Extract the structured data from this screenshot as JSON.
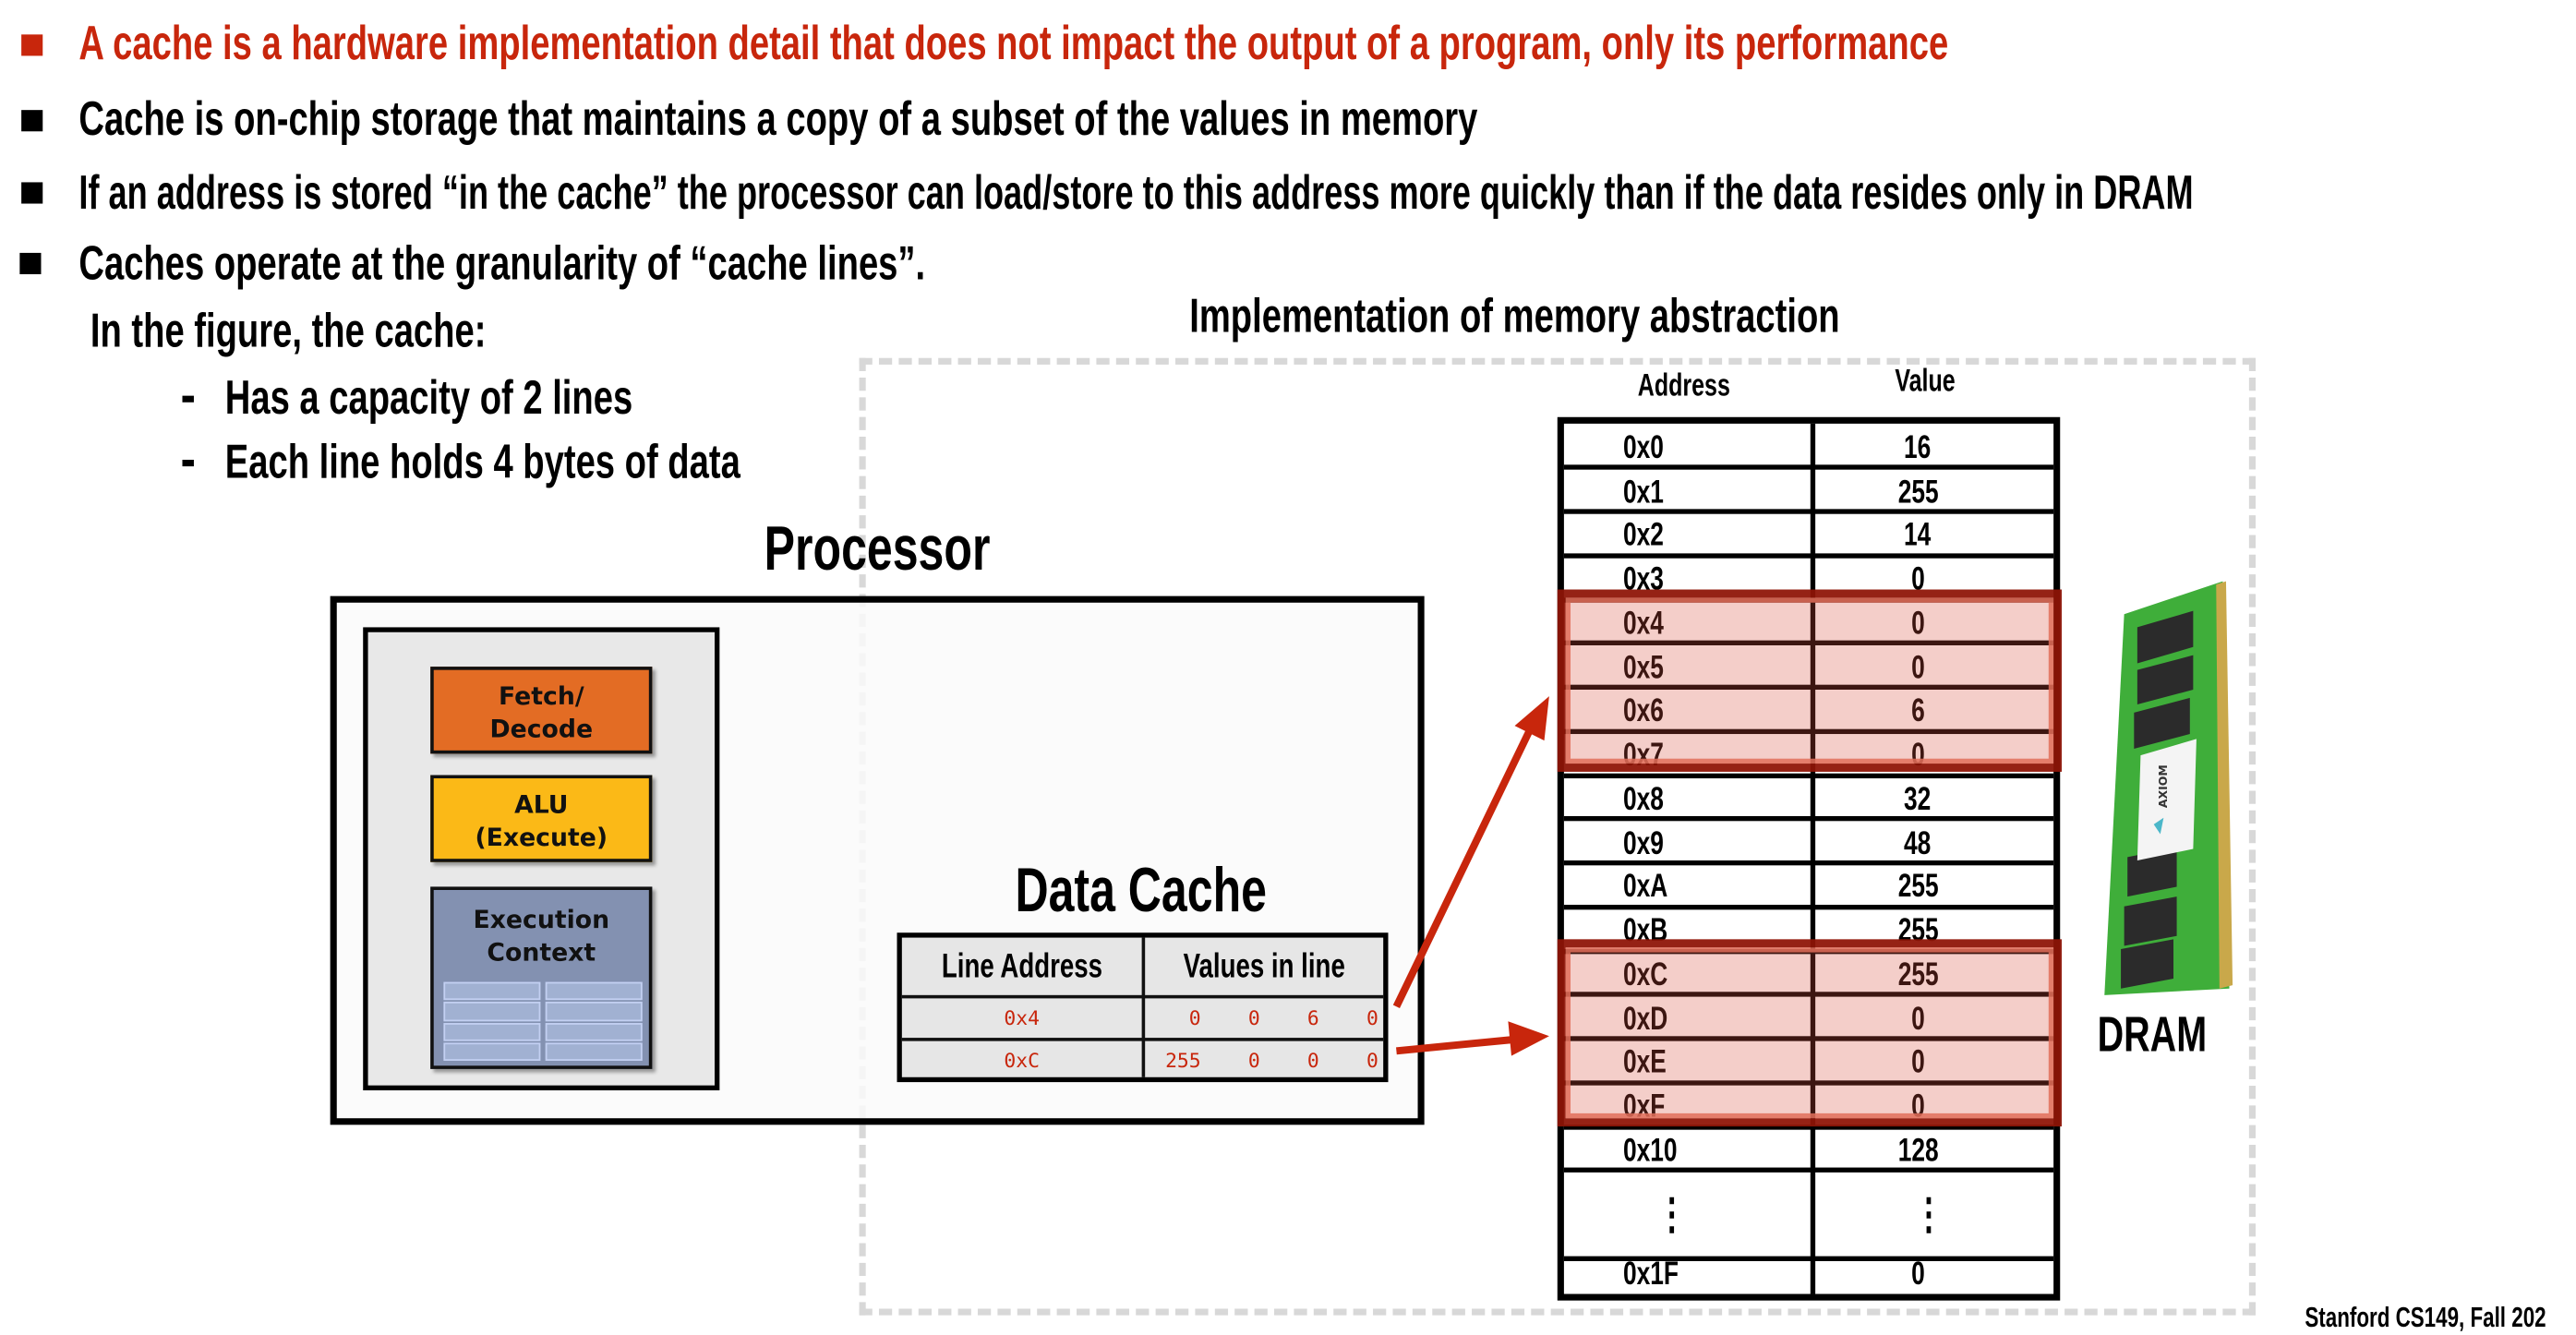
{
  "bullets": [
    {
      "text": "A cache is a hardware implementation detail that does not impact the output of a program, only its performance",
      "color": "#c8260c"
    },
    {
      "text": "Cache is on-chip storage that maintains a copy of a subset of the values in memory",
      "color": "#000000"
    },
    {
      "text": "If an address is stored “in the cache” the processor can load/store to this address more quickly than if the data resides only in DRAM",
      "color": "#000000"
    },
    {
      "text": "Caches operate at the granularity of “cache lines”.",
      "color": "#000000"
    }
  ],
  "figure_intro": "In the figure, the cache:",
  "sub_bullets": [
    "Has a capacity of 2 lines",
    "Each line holds 4 bytes of data"
  ],
  "implementation_title": "Implementation of memory abstraction",
  "processor": {
    "title": "Processor",
    "units": {
      "fetch_decode": [
        "Fetch/",
        "Decode"
      ],
      "alu": [
        "ALU",
        "(Execute)"
      ],
      "execution_context": [
        "Execution",
        "Context"
      ]
    },
    "colors": {
      "fetch_decode": "#e36c24",
      "alu": "#fbb917",
      "execution_context": "#8391b1"
    }
  },
  "data_cache": {
    "title": "Data Cache",
    "headers": [
      "Line Address",
      "Values in line"
    ],
    "rows": [
      {
        "address": "0x4",
        "values": [
          "0",
          "0",
          "6",
          "0"
        ]
      },
      {
        "address": "0xC",
        "values": [
          "255",
          "0",
          "0",
          "0"
        ]
      }
    ],
    "text_color": "#c8260c"
  },
  "memory": {
    "headers": {
      "address": "Address",
      "value": "Value"
    },
    "rows": [
      {
        "address": "0x0",
        "value": "16"
      },
      {
        "address": "0x1",
        "value": "255"
      },
      {
        "address": "0x2",
        "value": "14"
      },
      {
        "address": "0x3",
        "value": "0"
      },
      {
        "address": "0x4",
        "value": "0"
      },
      {
        "address": "0x5",
        "value": "0"
      },
      {
        "address": "0x6",
        "value": "6"
      },
      {
        "address": "0x7",
        "value": "0"
      },
      {
        "address": "0x8",
        "value": "32"
      },
      {
        "address": "0x9",
        "value": "48"
      },
      {
        "address": "0xA",
        "value": "255"
      },
      {
        "address": "0xB",
        "value": "255"
      },
      {
        "address": "0xC",
        "value": "255"
      },
      {
        "address": "0xD",
        "value": "0"
      },
      {
        "address": "0xE",
        "value": "0"
      },
      {
        "address": "0xF",
        "value": "0"
      },
      {
        "address": "0x10",
        "value": "128"
      }
    ],
    "ellipsis": {
      "address": "⋮",
      "value": "⋮"
    },
    "last_row": {
      "address": "0x1F",
      "value": "0"
    },
    "cached_lines": [
      "0x4",
      "0xC"
    ],
    "highlight_color": "#8c1405"
  },
  "dram": {
    "label": "DRAM",
    "brand": "AXIOM"
  },
  "footer": "Stanford CS149, Fall 202"
}
